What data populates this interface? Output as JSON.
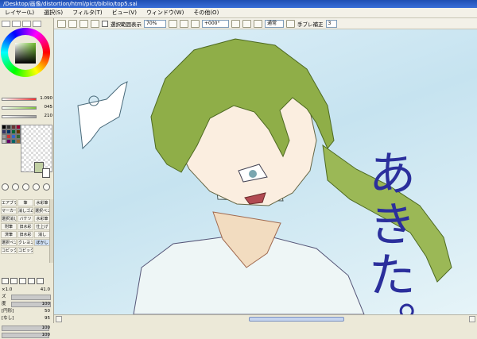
{
  "window": {
    "title": "/Desktop/画像/distortion/html/pict/biblio/top5.sai"
  },
  "menu": [
    "レイヤー(L)",
    "選択(S)",
    "フィルタ(T)",
    "ビュー(V)",
    "ウィンドウ(W)",
    "その他(O)"
  ],
  "toolbar": {
    "selection_label": "選択範囲表示",
    "zoom": "70%",
    "rotation": "+000°",
    "mode": "通常",
    "stabilizer_label": "手ブレ補正",
    "stabilizer_value": "3"
  },
  "color": {
    "slider1_value": "1.090",
    "slider2_value": "045",
    "slider3_value": "210",
    "primary": "#c1d0a4",
    "secondary": "#ffffff",
    "swatches": [
      "#000000",
      "#333333",
      "#663333",
      "#990033",
      "#333366",
      "#003366",
      "#006633",
      "#663300",
      "#999999",
      "#cc3333",
      "#3366cc",
      "#336633",
      "#cccccc",
      "#660066",
      "#006666",
      "#996633"
    ]
  },
  "brushes": [
    "エアブラシ",
    "筆",
    "水彩筆",
    "マーカー",
    "消しゴム",
    "選択ペン",
    "選択消し",
    "バケツ",
    "水彩筆",
    "附筆",
    "旧水彩",
    "仕上げ",
    "済筆",
    "旧水彩",
    "消し",
    "選択ペン",
    "クレヨン",
    "ぼかし",
    "コピック",
    "コピック"
  ],
  "brush_selected_index": 17,
  "props": {
    "size_multiplier": "×1.0",
    "size_value": "41.0",
    "size_label": "ズ",
    "density_value": "100",
    "density_label": "度",
    "shape_label": "[円形]",
    "shape_value": "50",
    "texture_label": "[なし]",
    "texture_value": "95",
    "blend1_value": "100",
    "blend2_value": "100"
  },
  "canvas": {
    "handwriting": "あきた。",
    "text_color": "#2b2f9c"
  }
}
